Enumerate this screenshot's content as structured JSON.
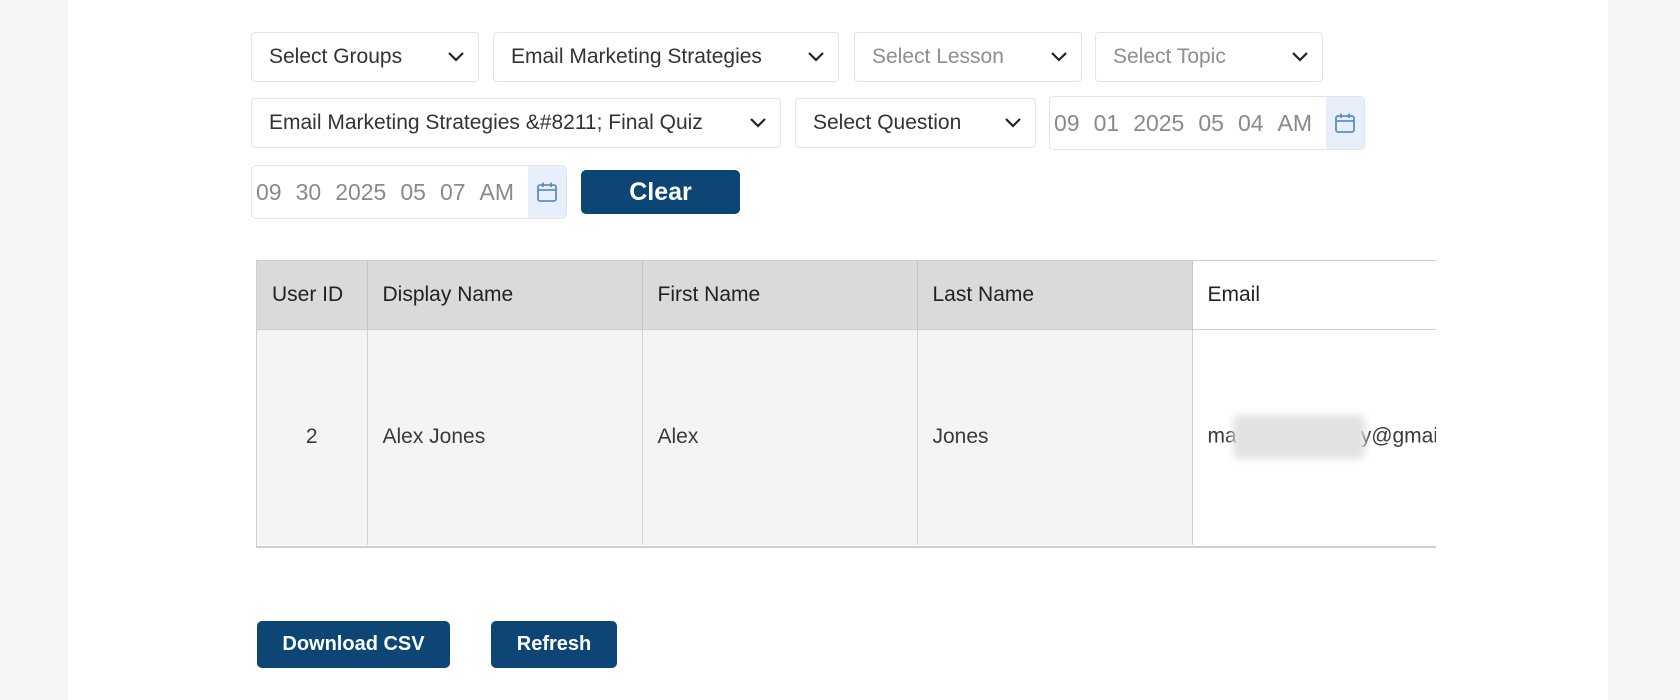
{
  "filters": {
    "groups": "Select Groups",
    "course": "Email Marketing Strategies",
    "lesson": "Select Lesson",
    "topic": "Select Topic",
    "quiz": "Email Marketing Strategies &#8211; Final Quiz",
    "question": "Select Question"
  },
  "date_start": {
    "month": "09",
    "day": "01",
    "year": "2025",
    "hour": "05",
    "minute": "04",
    "ampm": "AM"
  },
  "date_end": {
    "month": "09",
    "day": "30",
    "year": "2025",
    "hour": "05",
    "minute": "07",
    "ampm": "AM"
  },
  "clear_label": "Clear",
  "table": {
    "headers": [
      "User ID",
      "Display Name",
      "First Name",
      "Last Name",
      "Email"
    ],
    "rows": [
      {
        "user_id": "2",
        "display_name": "Alex Jones",
        "first_name": "Alex",
        "last_name": "Jones",
        "email_start": "ma",
        "email_end": "y@gmai."
      }
    ]
  },
  "actions": {
    "download": "Download CSV",
    "refresh": "Refresh"
  },
  "colors": {
    "primary": "#0d4675",
    "calendar_bg": "#e7f0fa",
    "header_bg": "#dadada"
  }
}
